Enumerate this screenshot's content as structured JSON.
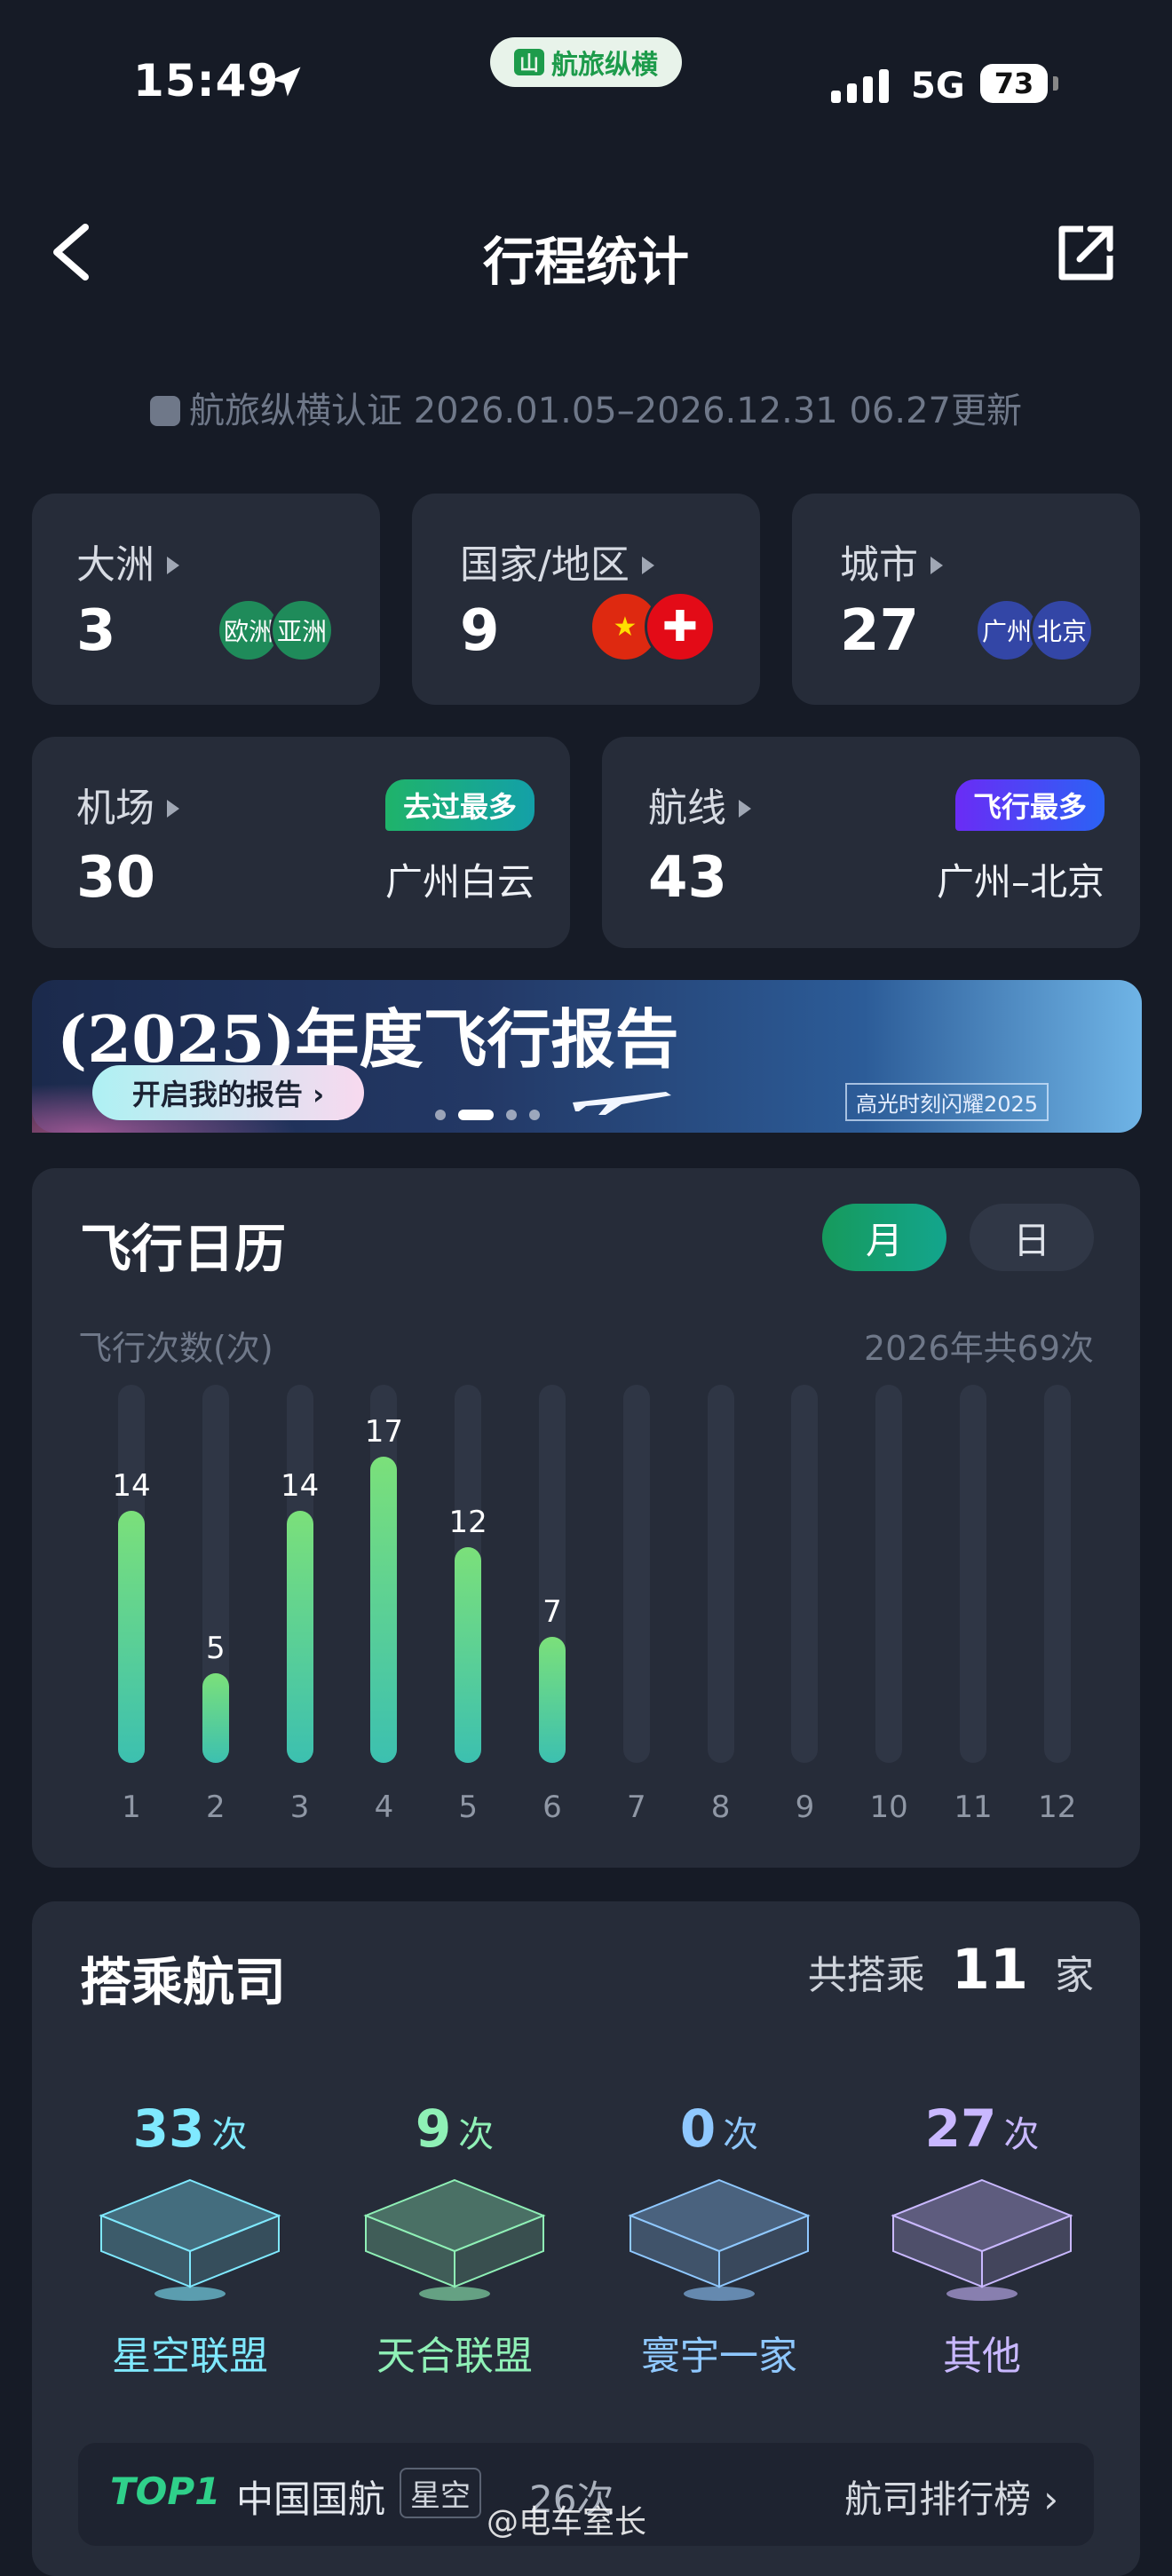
{
  "status_bar": {
    "time": "15:49",
    "app_pill": "航旅纵横",
    "network": "5G",
    "battery": "73"
  },
  "header": {
    "title": "行程统计"
  },
  "certification": "航旅纵横认证 2026.01.05–2026.12.31 06.27更新",
  "stats": {
    "continent": {
      "label": "大洲",
      "value": "3",
      "chips": [
        "欧洲",
        "亚洲"
      ]
    },
    "country": {
      "label": "国家/地区",
      "value": "9"
    },
    "city": {
      "label": "城市",
      "value": "27",
      "chips": [
        "广州",
        "北京"
      ]
    },
    "airport": {
      "label": "机场",
      "value": "30",
      "badge": "去过最多",
      "top": "广州白云"
    },
    "route": {
      "label": "航线",
      "value": "43",
      "badge": "飞行最多",
      "top": "广州–北京"
    }
  },
  "banner": {
    "title": "(2025)年度飞行报告",
    "button": "开启我的报告 ›",
    "tag": "高光时刻闪耀2025"
  },
  "calendar": {
    "title": "飞行日历",
    "toggle_month": "月",
    "toggle_day": "日",
    "ylabel": "飞行次数(次)",
    "summary": "2026年共69次"
  },
  "chart_data": {
    "type": "bar",
    "categories": [
      "1",
      "2",
      "3",
      "4",
      "5",
      "6",
      "7",
      "8",
      "9",
      "10",
      "11",
      "12"
    ],
    "values": [
      14,
      5,
      14,
      17,
      12,
      7,
      null,
      null,
      null,
      null,
      null,
      null
    ],
    "ylabel": "飞行次数(次)",
    "ylim": [
      0,
      21
    ]
  },
  "airlines": {
    "title": "搭乘航司",
    "total_prefix": "共搭乘",
    "total": "11",
    "total_suffix": "家",
    "alliances": [
      {
        "count": "33",
        "unit": "次",
        "name": "星空联盟",
        "color": "#7fe9ff"
      },
      {
        "count": "9",
        "unit": "次",
        "name": "天合联盟",
        "color": "#8ff0b6"
      },
      {
        "count": "0",
        "unit": "次",
        "name": "寰宇一家",
        "color": "#8fc8ff"
      },
      {
        "count": "27",
        "unit": "次",
        "name": "其他",
        "color": "#c9b8ff"
      }
    ],
    "top": {
      "rank": "TOP1",
      "airline": "中国国航",
      "alliance": "星空",
      "count": "26次",
      "ranking_link": "航司排行榜"
    }
  },
  "watermark": "@电车室长"
}
